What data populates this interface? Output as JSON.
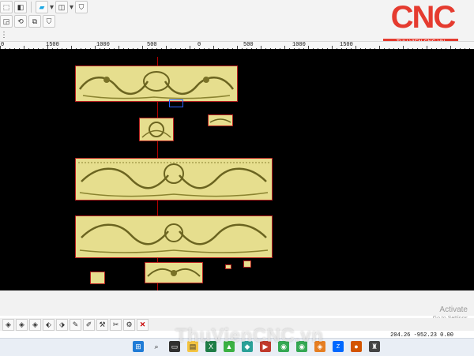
{
  "logo": {
    "text": "CNC",
    "subtitle": "THU VIEN CNC.VN"
  },
  "ruler": {
    "labels": [
      "0",
      "1500",
      "1000",
      "500",
      "0",
      "500",
      "1000",
      "1500"
    ]
  },
  "statusbar": {
    "coords": "204.26 -952.23 0.00"
  },
  "activate": {
    "line1": "Activate",
    "line2": "Go to Settings"
  },
  "watermark": {
    "text": "ThuVienCNC.vn"
  },
  "toolbar": {
    "top_row_icons": [
      "select-icon",
      "3d-view-icon",
      "layer-icon",
      "dropdown-icon",
      "move-icon",
      "dropdown-icon",
      "shield-icon"
    ],
    "second_row_icons": [
      "scale-icon",
      "rotate-icon",
      "copy-icon",
      "shield-icon"
    ],
    "third_row_icons": [
      "snap-icon",
      "offset-icon",
      "align-icon",
      "array-icon",
      "zoom-icon",
      "ellipsis-icon"
    ]
  },
  "bottom_toolbar": {
    "icons": [
      "diamond-icon",
      "diamond-icon",
      "diamond-icon",
      "sculpt-icon",
      "sculpt-icon",
      "tool-icon",
      "tool-icon",
      "tool-icon",
      "tool-icon",
      "tool-icon",
      "delete-icon"
    ]
  },
  "taskbar": {
    "apps": [
      "windows-start-icon",
      "search-icon",
      "file-explorer-icon",
      "explorer-icon",
      "excel-icon",
      "app-icon",
      "app-icon",
      "app-icon",
      "chrome-icon",
      "chrome-icon",
      "app-icon",
      "zalo-icon",
      "app-icon",
      "app-icon"
    ]
  },
  "colors": {
    "brand": "#e53b2f",
    "canvas": "#000000",
    "panel": "#e6de8e",
    "outline": "#b52020"
  }
}
